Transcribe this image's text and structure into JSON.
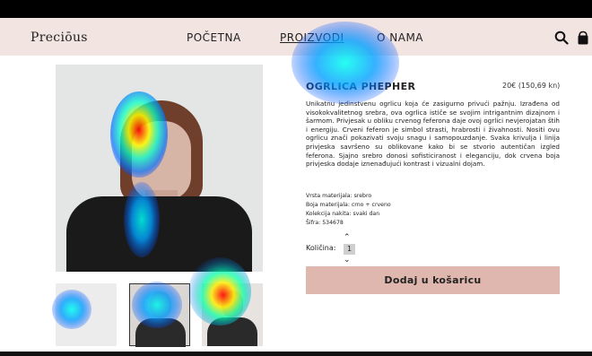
{
  "header": {
    "brand": "Preciōus",
    "nav": [
      "POČETNA",
      "PROIZVODI",
      "O NAMA"
    ],
    "active_nav": "PROIZVODI"
  },
  "product": {
    "title": "OGRLICA PHEPHER",
    "price": "20€ (150,69 kn)",
    "description": "Unikatnu jedinstvenu ogrlicu koja će zasigurno privući pažnju. Izrađena od visokokvalitetnog srebra, ova ogrlica ističe se svojim intrigantnim dizajnom i šarmom. Privjesak u obliku crvenog feferona daje ovoj ogrlici nevjerojatan štih i energiju. Crveni feferon je simbol strasti, hrabrosti i živahnosti. Nositi ovu ogrlicu znači pokazivati svoju snagu i samopouzdanje. Svaka krivulja i linija privjeska savršeno su oblikovane kako bi se stvorio autentičan izgled feferona. Sjajno srebro donosi sofisticiranost i eleganciju, dok crvena boja privjeska dodaje iznenađujući kontrast i vizualni dojam.",
    "specs": [
      "Vrsta materijala: srebro",
      "Boja materijala: crno + crveno",
      "Kolekcija nakita: svaki dan",
      "Šifra: 534678"
    ],
    "quantity_label": "Količina:",
    "quantity": "1",
    "add_to_cart": "Dodaj u košaricu"
  },
  "colors": {
    "nav_bg": "#f1e4e1",
    "button_bg": "#dfb7ae"
  },
  "icons": [
    "search-icon",
    "shopping-bag-icon",
    "chevron-up-icon",
    "chevron-down-icon"
  ]
}
